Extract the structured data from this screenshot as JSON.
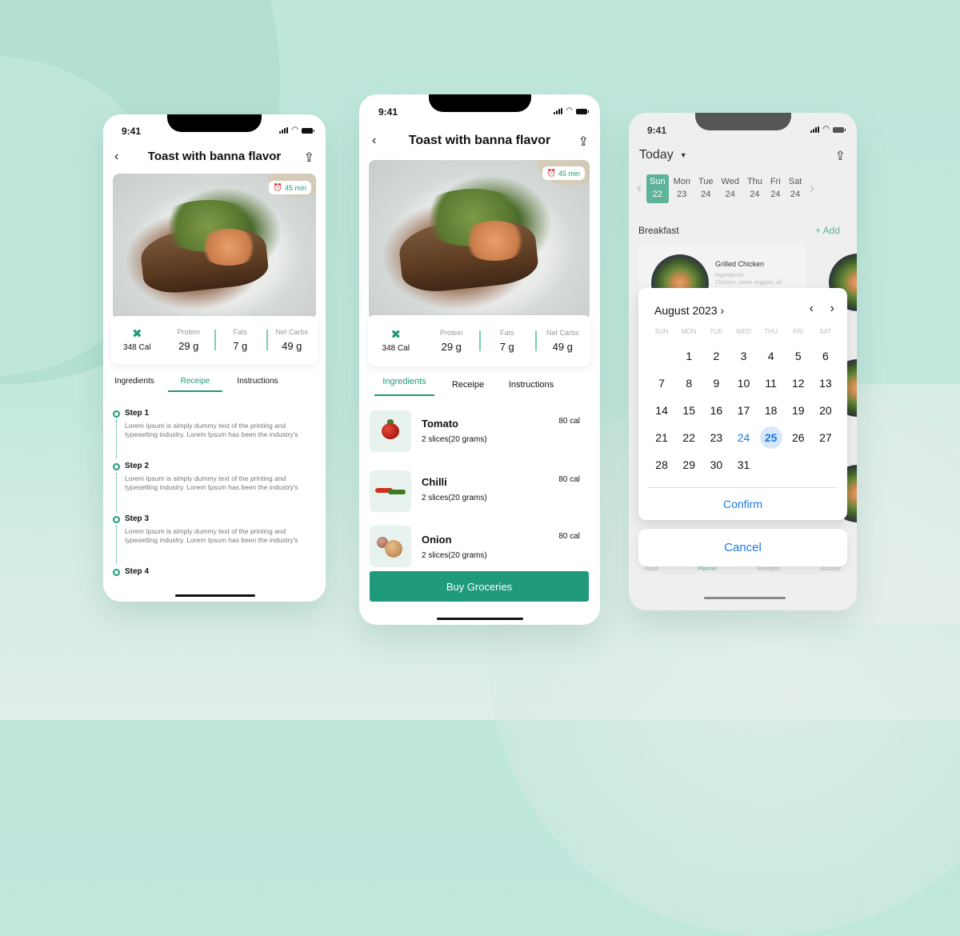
{
  "status": {
    "time": "9:41"
  },
  "recipe": {
    "title": "Toast with banna flavor",
    "time_badge": "45 min",
    "calories": "348 Cal",
    "macros": [
      {
        "label": "Protein",
        "value": "29 g"
      },
      {
        "label": "Fats",
        "value": "7 g"
      },
      {
        "label": "Net Carbs",
        "value": "49 g"
      }
    ],
    "tabs": [
      "Ingredients",
      "Receipe",
      "Instructions"
    ]
  },
  "phone1": {
    "active_tab": "Receipe",
    "steps": [
      {
        "title": "Step 1",
        "desc": "Lorem Ipsum is simply dummy text of the printing and typesetting industry. Lorem Ipsum has been the industry's"
      },
      {
        "title": "Step 2",
        "desc": "Lorem Ipsum is simply dummy text of the printing and typesetting industry. Lorem Ipsum has been the industry's"
      },
      {
        "title": "Step 3",
        "desc": "Lorem Ipsum is simply dummy text of the printing and typesetting industry. Lorem Ipsum has been the industry's"
      },
      {
        "title": "Step 4",
        "desc": ""
      }
    ]
  },
  "phone2": {
    "active_tab": "Ingredients",
    "ingredients": [
      {
        "name": "Tomato",
        "qty": "2 slices(20 grams)",
        "cal": "80 cal",
        "icon": "tomato-icon"
      },
      {
        "name": "Chilli",
        "qty": "2 slices(20 grams)",
        "cal": "80 cal",
        "icon": "chilli-icon"
      },
      {
        "name": "Onion",
        "qty": "2 slices(20 grams)",
        "cal": "80 cal",
        "icon": "onion-icon"
      }
    ],
    "buy_button": "Buy Groceries"
  },
  "planner": {
    "today_label": "Today",
    "week": [
      {
        "day": "Sun",
        "date": "22",
        "selected": true
      },
      {
        "day": "Mon",
        "date": "23"
      },
      {
        "day": "Tue",
        "date": "24"
      },
      {
        "day": "Wed",
        "date": "24"
      },
      {
        "day": "Thu",
        "date": "24"
      },
      {
        "day": "Fri",
        "date": "24"
      },
      {
        "day": "Sat",
        "date": "24"
      }
    ],
    "section": "Breakfast",
    "add_label": "+ Add",
    "meal": {
      "name": "Grilled Chicken",
      "ingredients_label": "Ingredients:",
      "ingredients": "Chicken, some veggies, oil"
    },
    "picker": {
      "month": "August 2023",
      "weekdays": [
        "SUN",
        "MON",
        "TUE",
        "WED",
        "THU",
        "FRI",
        "SAT"
      ],
      "first_weekday_offset": 1,
      "days_in_month": 31,
      "today": 24,
      "selected": 25,
      "confirm": "Confirm",
      "cancel": "Cancel"
    },
    "tabbar": [
      "Food",
      "Planner",
      "Receipes",
      "Account"
    ],
    "active_tab": "Planner"
  },
  "colors": {
    "accent": "#1f9a7a",
    "accent_light": "#5eb39a",
    "ios_blue": "#1a7ae0"
  }
}
